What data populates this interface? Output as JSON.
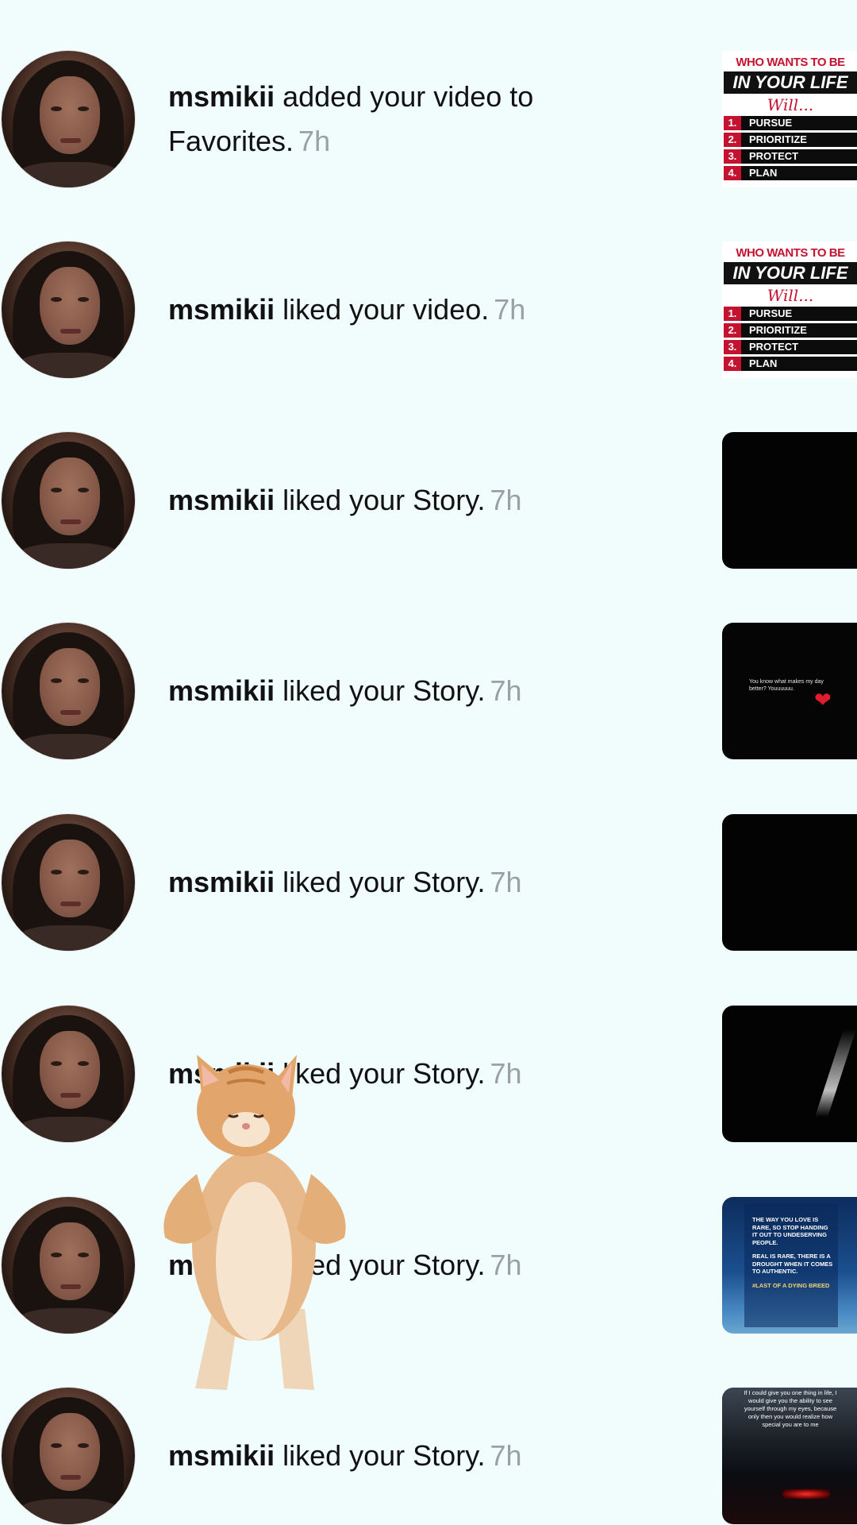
{
  "notifications": [
    {
      "username": "msmikii",
      "action": "added your video to Favorites.",
      "time": "7h",
      "thumbnail": "poster"
    },
    {
      "username": "msmikii",
      "action": "liked your video.",
      "time": "7h",
      "thumbnail": "poster"
    },
    {
      "username": "msmikii",
      "action": "liked your Story.",
      "time": "7h",
      "thumbnail": "black"
    },
    {
      "username": "msmikii",
      "action": "liked your Story.",
      "time": "7h",
      "thumbnail": "black-heart"
    },
    {
      "username": "msmikii",
      "action": "liked your Story.",
      "time": "7h",
      "thumbnail": "black"
    },
    {
      "username": "msmikii",
      "action": "liked your Story.",
      "time": "7h",
      "thumbnail": "black-streak"
    },
    {
      "username": "msmikii",
      "action": "liked your Story.",
      "time": "7h",
      "thumbnail": "blue-quote"
    },
    {
      "username": "msmikii",
      "action": "liked your Story.",
      "time": "7h",
      "thumbnail": "night-quote"
    }
  ],
  "poster": {
    "top": "WHO WANTS TO BE",
    "banner": "IN YOUR LIFE",
    "script": "Will...",
    "items": [
      {
        "num": "1.",
        "label": "PURSUE"
      },
      {
        "num": "2.",
        "label": "PRIORITIZE"
      },
      {
        "num": "3.",
        "label": "PROTECT"
      },
      {
        "num": "4.",
        "label": "PLAN"
      }
    ]
  },
  "story_heart_text": "You know what makes my day better? Youuuuuu.",
  "story_blue": {
    "line1": "THE WAY YOU LOVE IS RARE, SO STOP HANDING IT OUT TO UNDESERVING PEOPLE.",
    "line2": "REAL IS RARE, THERE IS A DROUGHT WHEN IT COMES TO AUTHENTIC.",
    "tag": "#LAST OF A DYING BREED"
  },
  "story_night_text": "If I could give you one thing in life, I would give you the ability to see yourself through my eyes, because only then you would realize how special you are to me",
  "colors": {
    "background": "#f1fcfd",
    "timestamp": "#9aa0a6",
    "poster_red": "#c41230"
  },
  "sticker": "dancing-cat-sticker"
}
